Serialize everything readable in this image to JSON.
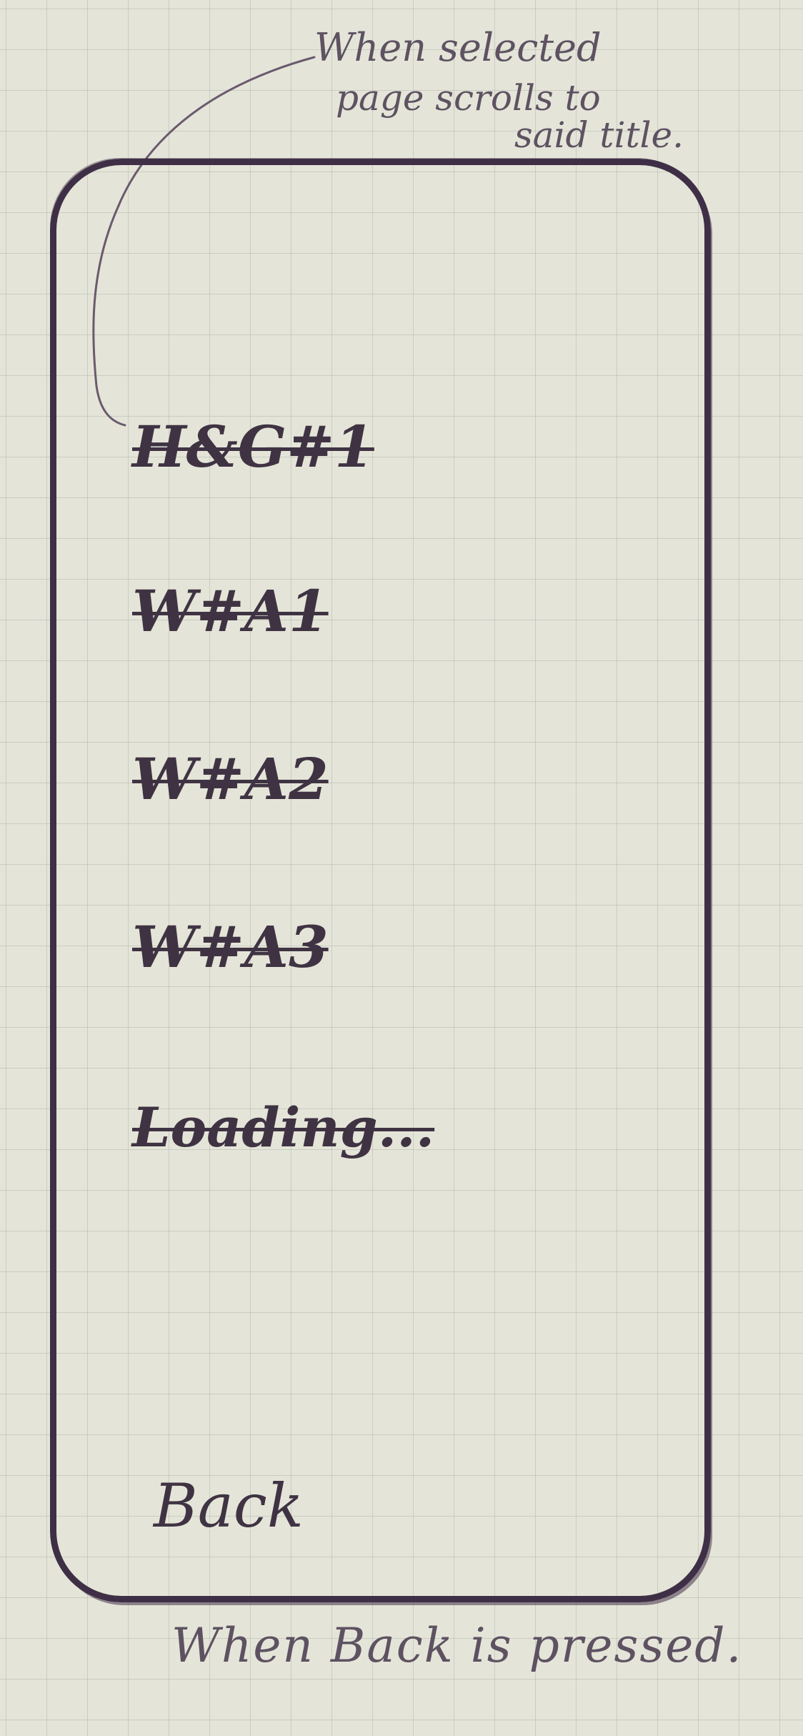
{
  "annotations": {
    "top_line_1": "When selected",
    "top_line_2": "page scrolls to",
    "top_line_3": "said title.",
    "bottom": "When Back is pressed."
  },
  "menu": {
    "items": [
      {
        "label": "H&G#1"
      },
      {
        "label": "W#A1"
      },
      {
        "label": "W#A2"
      },
      {
        "label": "W#A3"
      },
      {
        "label": "Loading..."
      }
    ]
  },
  "back": {
    "label": "Back"
  },
  "colors": {
    "ink": "#3f2f46",
    "paper": "#e4e5d8"
  }
}
